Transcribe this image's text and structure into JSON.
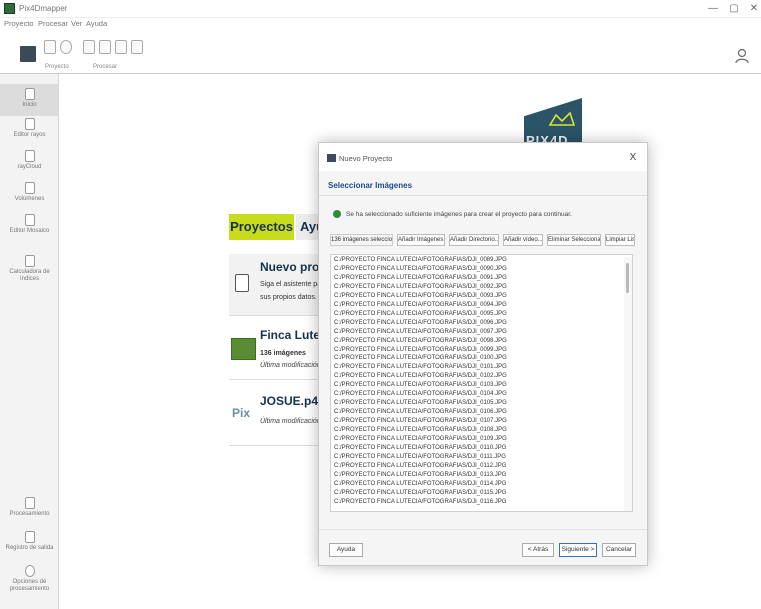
{
  "app": {
    "title": "Pix4Dmapper"
  },
  "window_controls": {
    "minimize": "—",
    "maximize": "▢",
    "close": "✕"
  },
  "menu": {
    "items": [
      "Proyecto",
      "Procesar",
      "Ver",
      "Ayuda"
    ]
  },
  "toolbar": {
    "group1_label": "Proyecto",
    "group2_label": "Procesar"
  },
  "sidebar": {
    "top_items": [
      {
        "label": "Inicio",
        "icon": "home-icon"
      },
      {
        "label": "Editor rayos",
        "icon": "rays-icon"
      },
      {
        "label": "rayCloud",
        "icon": "raycloud-icon"
      },
      {
        "label": "Volúmenes",
        "icon": "volume-icon"
      },
      {
        "label": "Editor Mosaico",
        "icon": "mosaic-icon"
      },
      {
        "label": "Calculadora de índices",
        "icon": "calculator-icon"
      }
    ],
    "bottom_items": [
      {
        "label": "Procesamiento",
        "icon": "processing-icon"
      },
      {
        "label": "Registro de salida",
        "icon": "log-icon"
      },
      {
        "label": "Opciones de procesamiento",
        "icon": "gear-icon"
      }
    ]
  },
  "main": {
    "logo_text": "PIX4D",
    "tabs": [
      "Proyectos",
      "Ayuda"
    ],
    "cards": [
      {
        "title": "Nuevo proyecto",
        "line1": "Siga el asistente para",
        "line2": "sus propios datos."
      },
      {
        "title": "Finca Lutecia",
        "line1": "136 imágenes",
        "line2": "Última modificación"
      },
      {
        "title": "JOSUE.p4d",
        "line1": "",
        "line2": "Última modificación"
      }
    ]
  },
  "dialog": {
    "title": "Nuevo Proyecto",
    "close": "X",
    "header": "Seleccionar Imágenes",
    "status": "Se ha seleccionado suficiente imágenes para crear el proyecto para continuar.",
    "buttons": [
      "136 imágenes seleccionadas",
      "Añadir Imágenes...",
      "Añadir Directorio...",
      "Añadir vídeo...",
      "Eliminar Seleccionado",
      "Limpiar Lista"
    ],
    "files": [
      "C:/PROYECTO FINCA LUTECIA/FOTOGRAFIAS/DJI_0089.JPG",
      "C:/PROYECTO FINCA LUTECIA/FOTOGRAFIAS/DJI_0090.JPG",
      "C:/PROYECTO FINCA LUTECIA/FOTOGRAFIAS/DJI_0091.JPG",
      "C:/PROYECTO FINCA LUTECIA/FOTOGRAFIAS/DJI_0092.JPG",
      "C:/PROYECTO FINCA LUTECIA/FOTOGRAFIAS/DJI_0093.JPG",
      "C:/PROYECTO FINCA LUTECIA/FOTOGRAFIAS/DJI_0094.JPG",
      "C:/PROYECTO FINCA LUTECIA/FOTOGRAFIAS/DJI_0095.JPG",
      "C:/PROYECTO FINCA LUTECIA/FOTOGRAFIAS/DJI_0096.JPG",
      "C:/PROYECTO FINCA LUTECIA/FOTOGRAFIAS/DJI_0097.JPG",
      "C:/PROYECTO FINCA LUTECIA/FOTOGRAFIAS/DJI_0098.JPG",
      "C:/PROYECTO FINCA LUTECIA/FOTOGRAFIAS/DJI_0099.JPG",
      "C:/PROYECTO FINCA LUTECIA/FOTOGRAFIAS/DJI_0100.JPG",
      "C:/PROYECTO FINCA LUTECIA/FOTOGRAFIAS/DJI_0101.JPG",
      "C:/PROYECTO FINCA LUTECIA/FOTOGRAFIAS/DJI_0102.JPG",
      "C:/PROYECTO FINCA LUTECIA/FOTOGRAFIAS/DJI_0103.JPG",
      "C:/PROYECTO FINCA LUTECIA/FOTOGRAFIAS/DJI_0104.JPG",
      "C:/PROYECTO FINCA LUTECIA/FOTOGRAFIAS/DJI_0105.JPG",
      "C:/PROYECTO FINCA LUTECIA/FOTOGRAFIAS/DJI_0106.JPG",
      "C:/PROYECTO FINCA LUTECIA/FOTOGRAFIAS/DJI_0107.JPG",
      "C:/PROYECTO FINCA LUTECIA/FOTOGRAFIAS/DJI_0108.JPG",
      "C:/PROYECTO FINCA LUTECIA/FOTOGRAFIAS/DJI_0109.JPG",
      "C:/PROYECTO FINCA LUTECIA/FOTOGRAFIAS/DJI_0110.JPG",
      "C:/PROYECTO FINCA LUTECIA/FOTOGRAFIAS/DJI_0111.JPG",
      "C:/PROYECTO FINCA LUTECIA/FOTOGRAFIAS/DJI_0112.JPG",
      "C:/PROYECTO FINCA LUTECIA/FOTOGRAFIAS/DJI_0113.JPG",
      "C:/PROYECTO FINCA LUTECIA/FOTOGRAFIAS/DJI_0114.JPG",
      "C:/PROYECTO FINCA LUTECIA/FOTOGRAFIAS/DJI_0115.JPG",
      "C:/PROYECTO FINCA LUTECIA/FOTOGRAFIAS/DJI_0116.JPG"
    ],
    "footer": {
      "help": "Ayuda",
      "back": "< Atrás",
      "next": "Siguiente >",
      "cancel": "Cancelar"
    }
  },
  "colors": {
    "accent_green": "#c8dc1e",
    "link_blue": "#1a4a8a",
    "pix4d_blue": "#2b5468",
    "ok_green": "#2e8b3a"
  }
}
